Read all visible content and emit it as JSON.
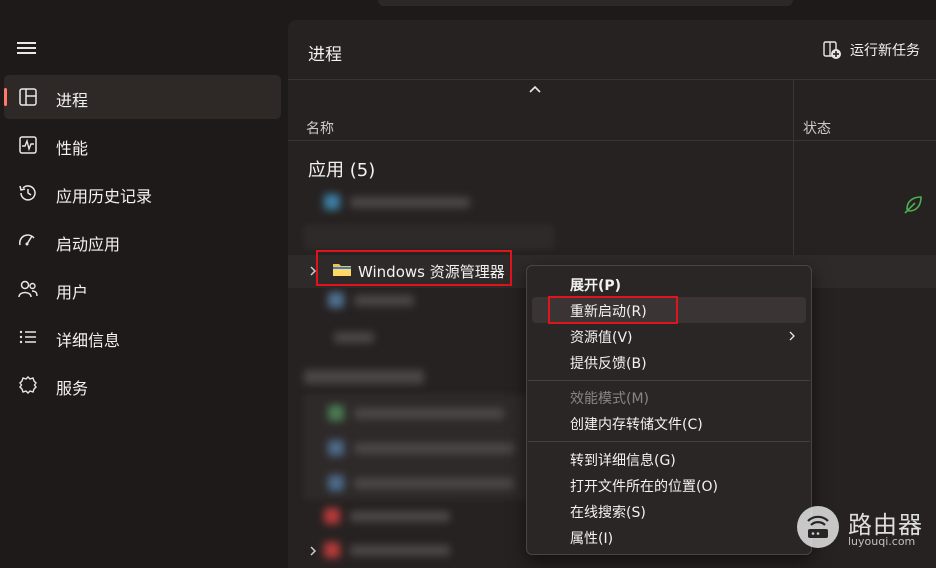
{
  "sidebar": {
    "items": [
      {
        "label": "进程",
        "icon": "processes-icon",
        "active": true
      },
      {
        "label": "性能",
        "icon": "performance-icon"
      },
      {
        "label": "应用历史记录",
        "icon": "history-icon"
      },
      {
        "label": "启动应用",
        "icon": "startup-icon"
      },
      {
        "label": "用户",
        "icon": "users-icon"
      },
      {
        "label": "详细信息",
        "icon": "details-icon"
      },
      {
        "label": "服务",
        "icon": "services-icon"
      }
    ]
  },
  "header": {
    "title": "进程",
    "run_new_task": "运行新任务"
  },
  "table": {
    "columns": [
      "名称",
      "状态"
    ],
    "group_apps": "应用 (5)",
    "selected_row": "Windows 资源管理器"
  },
  "context_menu": {
    "items": [
      {
        "label": "展开(P)",
        "bold": true
      },
      {
        "label": "重新启动(R)",
        "highlighted": true
      },
      {
        "label": "资源值(V)",
        "submenu": true
      },
      {
        "label": "提供反馈(B)"
      },
      {
        "label": "效能模式(M)",
        "disabled": true
      },
      {
        "label": "创建内存转储文件(C)"
      },
      {
        "label": "转到详细信息(G)"
      },
      {
        "label": "打开文件所在的位置(O)"
      },
      {
        "label": "在线搜索(S)"
      },
      {
        "label": "属性(I)"
      }
    ]
  },
  "watermark": {
    "brand": "路由器",
    "url": "luyouqi.com"
  },
  "colors": {
    "accent": "#ff7a6b",
    "annotation_red": "#e0141b",
    "efficiency_green": "#4caf50"
  }
}
